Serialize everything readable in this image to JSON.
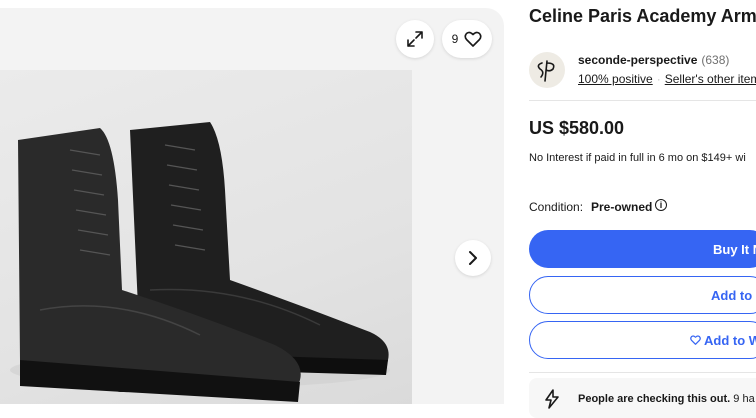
{
  "gallery": {
    "watch_count": "9",
    "icons": [
      "expand-icon",
      "heart-icon",
      "chevron-right-icon"
    ]
  },
  "listing": {
    "title": "Celine Paris Academy Army"
  },
  "seller": {
    "name": "seconde-perspective",
    "feedback_count": "(638)",
    "positive": "100% positive",
    "other_items": "Seller's other items"
  },
  "pricing": {
    "price": "US $580.00",
    "financing": "No Interest if paid in full in 6 mo on $149+ wi"
  },
  "condition": {
    "label": "Condition:",
    "value": "Pre-owned"
  },
  "actions": {
    "buy_label": "Buy It N",
    "cart_label": "Add to c",
    "watch_label": "Add to W"
  },
  "signal": {
    "bold_text": "People are checking this out.",
    "rest_text": " 9 ha"
  },
  "colors": {
    "accent": "#3665f3",
    "text": "#191919",
    "muted": "#707070"
  }
}
